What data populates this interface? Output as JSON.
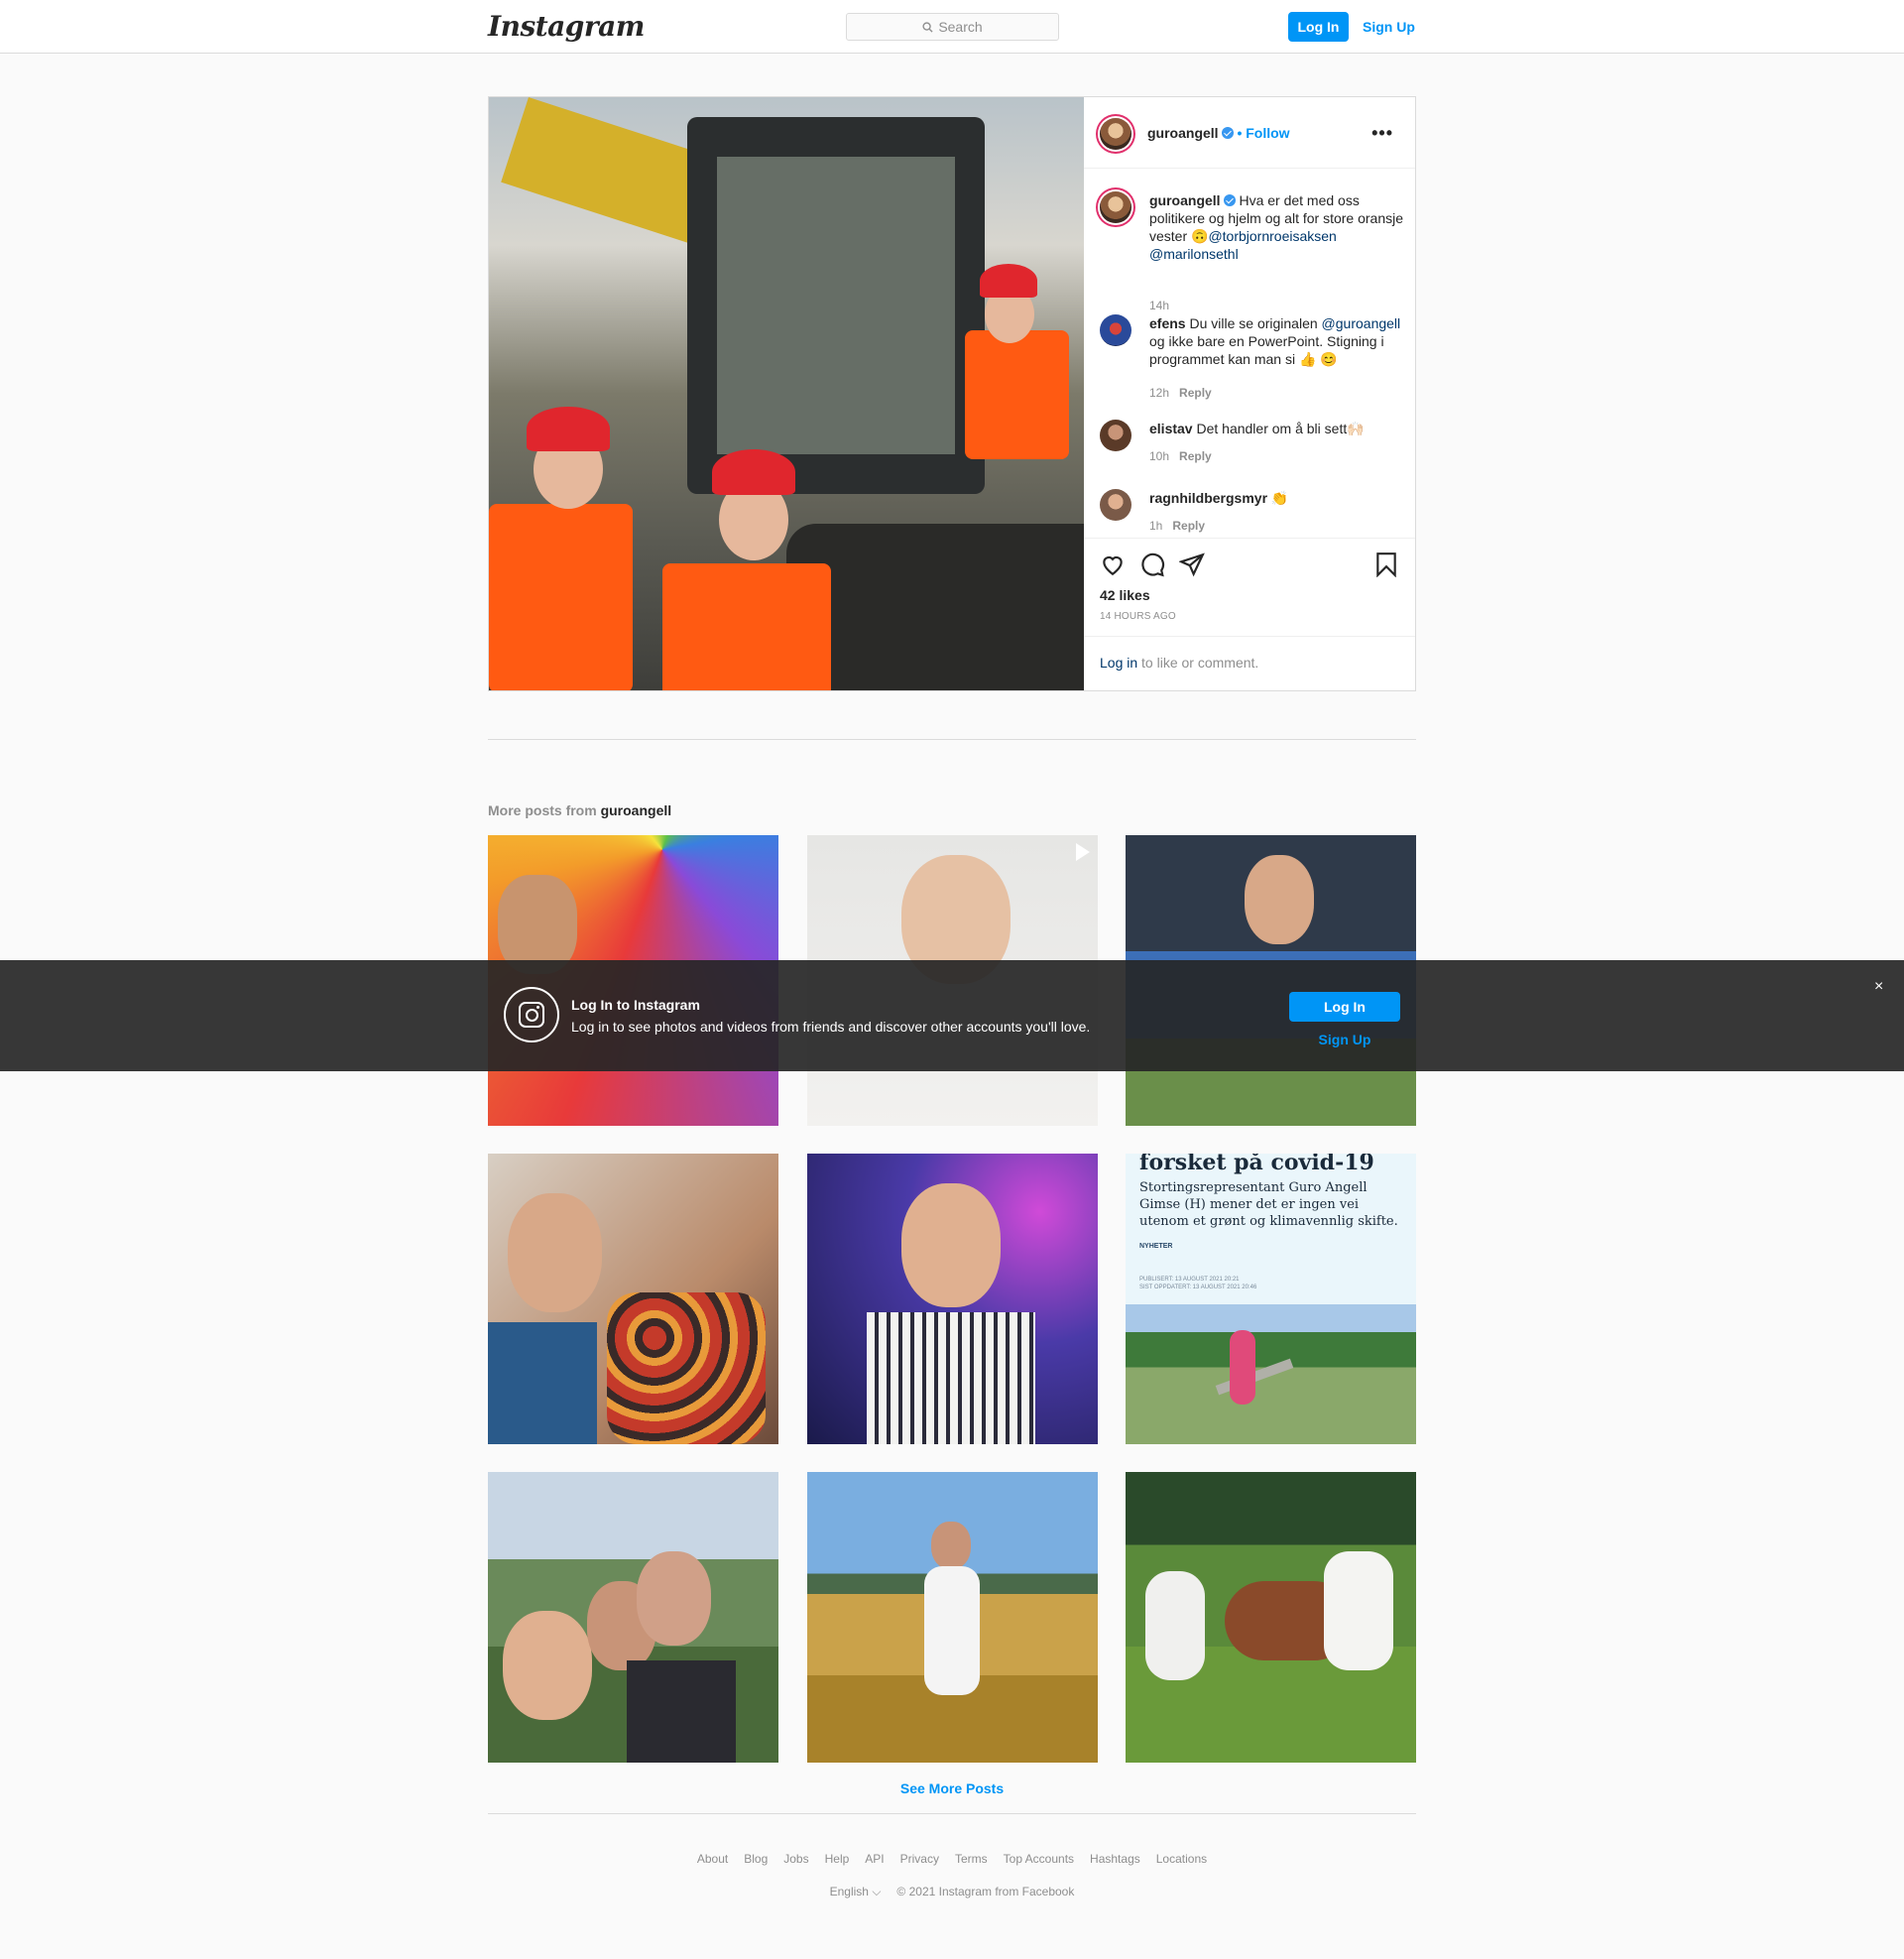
{
  "header": {
    "logo": "Instagram",
    "search_placeholder": "Search",
    "login_label": "Log In",
    "signup_label": "Sign Up"
  },
  "post": {
    "author": "guroangell",
    "follow_label": "• Follow",
    "more_label": "•••",
    "caption": {
      "author": "guroangell",
      "text": "Hva er det med oss politikere og hjelm og alt for store oransje vester 🙃",
      "mentions": [
        "@torbjornroeisaksen",
        "@marilonsethl"
      ],
      "time": "14h"
    },
    "comments": [
      {
        "author": "efens",
        "text_a": "Du ville se originalen ",
        "mention": "@guroangell",
        "text_b": " og ikke bare en PowerPoint. Stigning i programmet kan man si 👍 😊",
        "time": "12h",
        "reply": "Reply"
      },
      {
        "author": "elistav",
        "text": "Det handler om å bli sett🙌🏻",
        "time": "10h",
        "reply": "Reply"
      },
      {
        "author": "ragnhildbergsmyr",
        "text": "👏",
        "time": "1h",
        "reply": "Reply"
      }
    ],
    "likes": "42 likes",
    "time_ago": "14 HOURS AGO",
    "footer_link": "Log in",
    "footer_text": " to like or comment."
  },
  "more_posts": {
    "label": "More posts from ",
    "user": "guroangell",
    "see_more": "See More Posts"
  },
  "banner": {
    "title": "Log In to Instagram",
    "text": "Log in to see photos and videos from friends and discover other accounts you'll love.",
    "login_label": "Log In",
    "signup_label": "Sign Up",
    "close": "×"
  },
  "clipping_text": {
    "headline": "forsket på covid-19",
    "body": "Stortingsrepresentant Guro Angell Gimse (H) mener det er ingen vei utenom et grønt og klimavennlig skifte.",
    "tag": "NYHETER",
    "published": "PUBLISERT: 13 AUGUST 2021 20:21",
    "updated": "SIST OPPDATERT: 13 AUGUST 2021 20:46"
  },
  "footer": {
    "links": [
      "About",
      "Blog",
      "Jobs",
      "Help",
      "API",
      "Privacy",
      "Terms",
      "Top Accounts",
      "Hashtags",
      "Locations"
    ],
    "language": "English ⌵",
    "copyright": "© 2021 Instagram from Facebook"
  },
  "colors": {
    "accent": "#0095f6",
    "border": "#dbdbdb",
    "banner_bg": "#262626"
  }
}
